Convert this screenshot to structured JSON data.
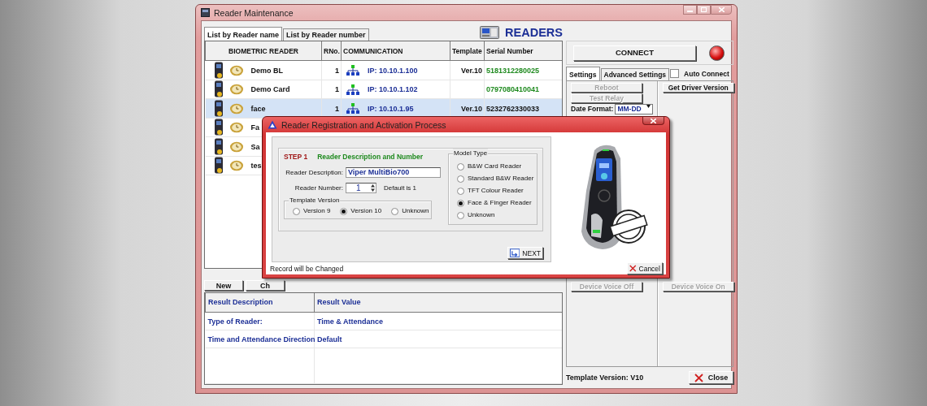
{
  "window": {
    "title": "Reader Maintenance",
    "header": "READERS"
  },
  "list_tabs": [
    {
      "label": "List by Reader name",
      "selected": true
    },
    {
      "label": "List by Reader number",
      "selected": false
    }
  ],
  "readers_table": {
    "columns": [
      "BIOMETRIC READER",
      "RNo.",
      "COMMUNICATION",
      "Template",
      "Serial Number"
    ],
    "rows": [
      {
        "name": "Demo BL",
        "number": "1",
        "address": "IP: 10.10.1.100",
        "template": "Ver.10",
        "serial": "5181312280025",
        "color": "#1f8a1f",
        "selected": false
      },
      {
        "name": "Demo Card",
        "number": "1",
        "address": "IP: 10.10.1.102",
        "serial": "0797080410041",
        "color": "#1f8a1f",
        "selected": false
      },
      {
        "name": "face",
        "number": "1",
        "address": "IP: 10.10.1.95",
        "template": "Ver.10",
        "serial": "5232762330033",
        "color": "#111111",
        "selected": true
      },
      {
        "name": "Fa",
        "selected": false
      },
      {
        "name": "Sa",
        "selected": false
      },
      {
        "name": "tes",
        "selected": false
      }
    ]
  },
  "list_buttons": [
    "New",
    "Ch"
  ],
  "results_table": {
    "columns": [
      "Result Description",
      "Result Value"
    ],
    "rows": [
      [
        "Type of Reader:",
        "Time & Attendance"
      ],
      [
        "Time and Attendance Direction",
        "Default"
      ]
    ]
  },
  "connection": {
    "button": "CONNECT",
    "connected": false
  },
  "settings_tabs": [
    {
      "label": "Settings",
      "selected": true
    },
    {
      "label": "Advanced Settings",
      "selected": false
    }
  ],
  "auto_connect": {
    "label": "Auto Connect",
    "checked": false
  },
  "settings_left": [
    {
      "kind": "button",
      "label": "Reboot",
      "disabled": true
    },
    {
      "kind": "button",
      "label": "Test Relay",
      "disabled": true
    },
    {
      "kind": "select",
      "label": "Date Format:",
      "value": "MM-DD"
    }
  ],
  "settings_right": [
    {
      "kind": "button",
      "label": "Get Driver Version",
      "disabled": false
    }
  ],
  "voice_buttons": [
    {
      "label": "Device Voice Off",
      "disabled": true
    },
    {
      "label": "Device Voice On",
      "disabled": true
    }
  ],
  "template_version": "Template Version: V10",
  "close_button": "Close",
  "dialog": {
    "title": "Reader Registration and Activation Process",
    "step": "STEP 1",
    "step_title": "Reader Description and Number",
    "description": {
      "label": "Reader Description:",
      "value": "Viper MultiBio700"
    },
    "number": {
      "label": "Reader Number:",
      "value": "1",
      "hint": "Default is 1"
    },
    "template_version": {
      "legend": "Template Version",
      "options": [
        {
          "label": "Version 9",
          "selected": false
        },
        {
          "label": "Version 10",
          "selected": true
        },
        {
          "label": "Unknown",
          "selected": false
        }
      ]
    },
    "model_type": {
      "legend": "Model Type",
      "options": [
        {
          "label": "B&W Card Reader",
          "selected": false
        },
        {
          "label": "Standard B&W Reader",
          "selected": false
        },
        {
          "label": "TFT Colour Reader",
          "selected": false
        },
        {
          "label": "Face & Finger Reader",
          "selected": true
        },
        {
          "label": "Unknown",
          "selected": false
        }
      ]
    },
    "next_button": "NEXT",
    "status": "Record will be Changed",
    "cancel_button": "Cancel"
  }
}
